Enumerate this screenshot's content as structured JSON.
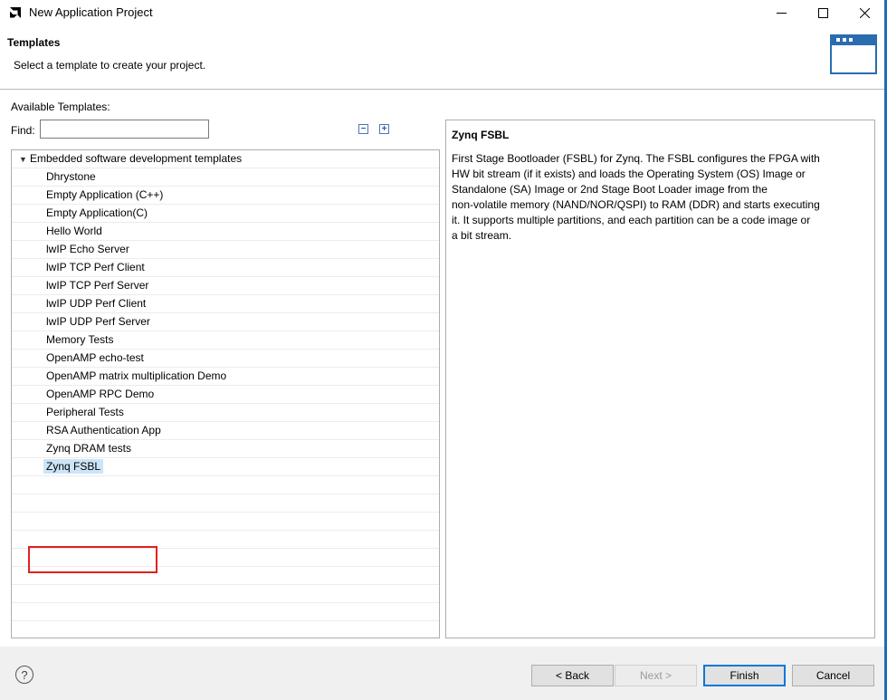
{
  "window": {
    "title": "New Application Project"
  },
  "banner": {
    "title": "Templates",
    "description": "Select a template to create your project."
  },
  "templates": {
    "available_label": "Available Templates:",
    "find_label": "Find:",
    "find_value": "",
    "category": "Embedded software development templates",
    "items": [
      "Dhrystone",
      "Empty Application (C++)",
      "Empty Application(C)",
      "Hello World",
      "lwIP Echo Server",
      "lwIP TCP Perf Client",
      "lwIP TCP Perf Server",
      "lwIP UDP Perf Client",
      "lwIP UDP Perf Server",
      "Memory Tests",
      "OpenAMP echo-test",
      "OpenAMP matrix multiplication Demo",
      "OpenAMP RPC Demo",
      "Peripheral Tests",
      "RSA Authentication App",
      "Zynq DRAM tests",
      "Zynq FSBL"
    ],
    "selected": "Zynq FSBL"
  },
  "description": {
    "title": "Zynq FSBL",
    "text": "First Stage Bootloader (FSBL) for Zynq. The FSBL configures the FPGA with\nHW bit stream (if it exists)  and loads the Operating System (OS) Image or\nStandalone (SA) Image or 2nd Stage Boot Loader image from the\nnon-volatile memory (NAND/NOR/QSPI) to RAM (DDR) and starts executing\nit.  It supports multiple partitions,  and each partition can be a code image or\na bit stream."
  },
  "footer": {
    "help_icon": "?",
    "back": "< Back",
    "next": "Next >",
    "finish": "Finish",
    "cancel": "Cancel"
  },
  "colors": {
    "selection": "#cce4f7",
    "highlight_box": "#e02020",
    "default_button_border": "#0078d7"
  }
}
